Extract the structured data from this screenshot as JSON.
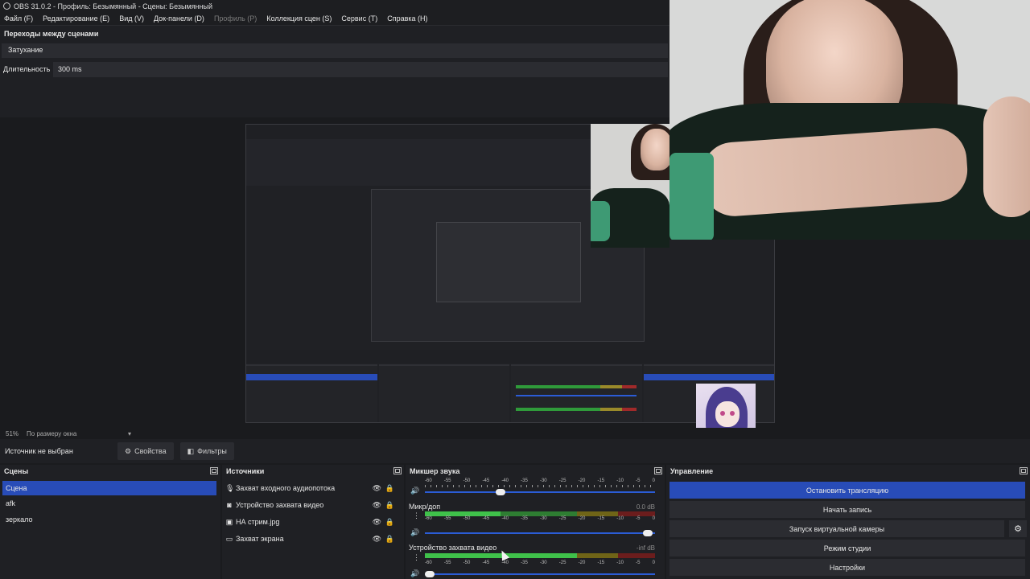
{
  "window": {
    "title": "OBS 31.0.2 - Профиль: Безымянный - Сцены: Безымянный"
  },
  "menu": [
    {
      "label": "Файл (F)"
    },
    {
      "label": "Редактирование (E)"
    },
    {
      "label": "Вид (V)"
    },
    {
      "label": "Док-панели (D)"
    },
    {
      "label": "Профиль (P)",
      "disabled": true
    },
    {
      "label": "Коллекция сцен (S)"
    },
    {
      "label": "Сервис (T)"
    },
    {
      "label": "Справка (H)"
    }
  ],
  "transitions": {
    "title": "Переходы между сценами",
    "selected": "Затухание",
    "duration_label": "Длительность",
    "duration_value": "300 ms"
  },
  "zoom": {
    "percent": "51%",
    "mode": "По размеру окна"
  },
  "context": {
    "no_source": "Источник не выбран",
    "properties": "Свойства",
    "filters": "Фильтры"
  },
  "scenes": {
    "title": "Сцены",
    "items": [
      {
        "label": "Сцена",
        "selected": true
      },
      {
        "label": "afk"
      },
      {
        "label": "зеркало"
      }
    ]
  },
  "sources": {
    "title": "Источники",
    "items": [
      {
        "label": "Захват входного аудиопотока",
        "icon": "microphone-icon"
      },
      {
        "label": "Устройство захвата видео",
        "icon": "camera-icon"
      },
      {
        "label": "НА стрим.jpg",
        "icon": "image-icon"
      },
      {
        "label": "Захват экрана",
        "icon": "monitor-icon"
      }
    ]
  },
  "mixer": {
    "title": "Микшер звука",
    "scale": [
      "-60",
      "-55",
      "-50",
      "-45",
      "-40",
      "-35",
      "-30",
      "-25",
      "-20",
      "-15",
      "-10",
      "-5",
      "0"
    ],
    "channels": [
      {
        "name": "",
        "db": "",
        "level": 0.0,
        "volume": 0.33
      },
      {
        "name": "Микр/доп",
        "db": "0.0 dB",
        "level": 0.33,
        "volume": 0.97
      },
      {
        "name": "Устройство захвата видео",
        "db": "-inf dB",
        "level": 0.66,
        "volume": 0.02
      }
    ]
  },
  "controls": {
    "title": "Управление",
    "buttons": [
      {
        "label": "Остановить трансляцию",
        "primary": true
      },
      {
        "label": "Начать запись"
      },
      {
        "label": "Запуск виртуальной камеры"
      },
      {
        "label": "Режим студии"
      },
      {
        "label": "Настройки"
      }
    ]
  },
  "colors": {
    "accent": "#284cb8",
    "meter_green": "#3fc14a",
    "meter_yellow": "#8a7b20",
    "meter_red": "#8a2424"
  }
}
